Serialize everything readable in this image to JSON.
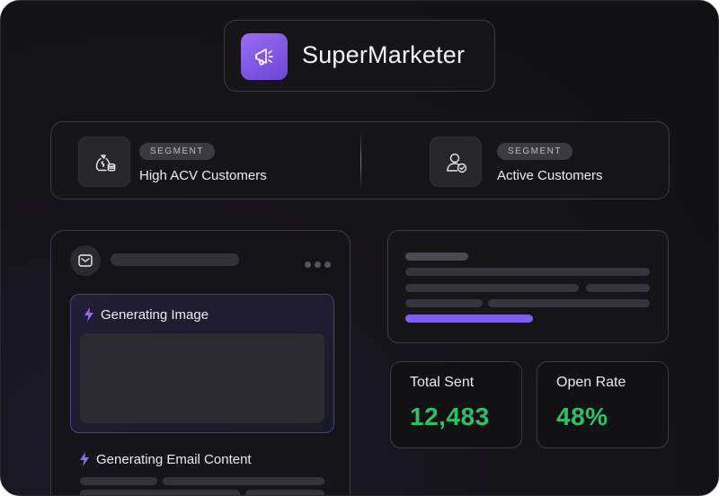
{
  "brand": {
    "name": "SuperMarketer",
    "icon": "megaphone-icon",
    "accent": "#7c55e6"
  },
  "segments": [
    {
      "tag": "SEGMENT",
      "name": "High ACV Customers",
      "icon": "money-bag-coins-icon"
    },
    {
      "tag": "SEGMENT",
      "name": "Active Customers",
      "icon": "user-check-icon"
    }
  ],
  "email_panel": {
    "icon": "mail-icon",
    "generating_image_label": "Generating Image",
    "generating_content_label": "Generating Email Content"
  },
  "stats": [
    {
      "label": "Total Sent",
      "value": "12,483"
    },
    {
      "label": "Open Rate",
      "value": "48%"
    }
  ],
  "colors": {
    "stat_value": "#2fbf68",
    "highlight_bar": "#7d5ef0",
    "card_border": "#4d3f8a"
  }
}
